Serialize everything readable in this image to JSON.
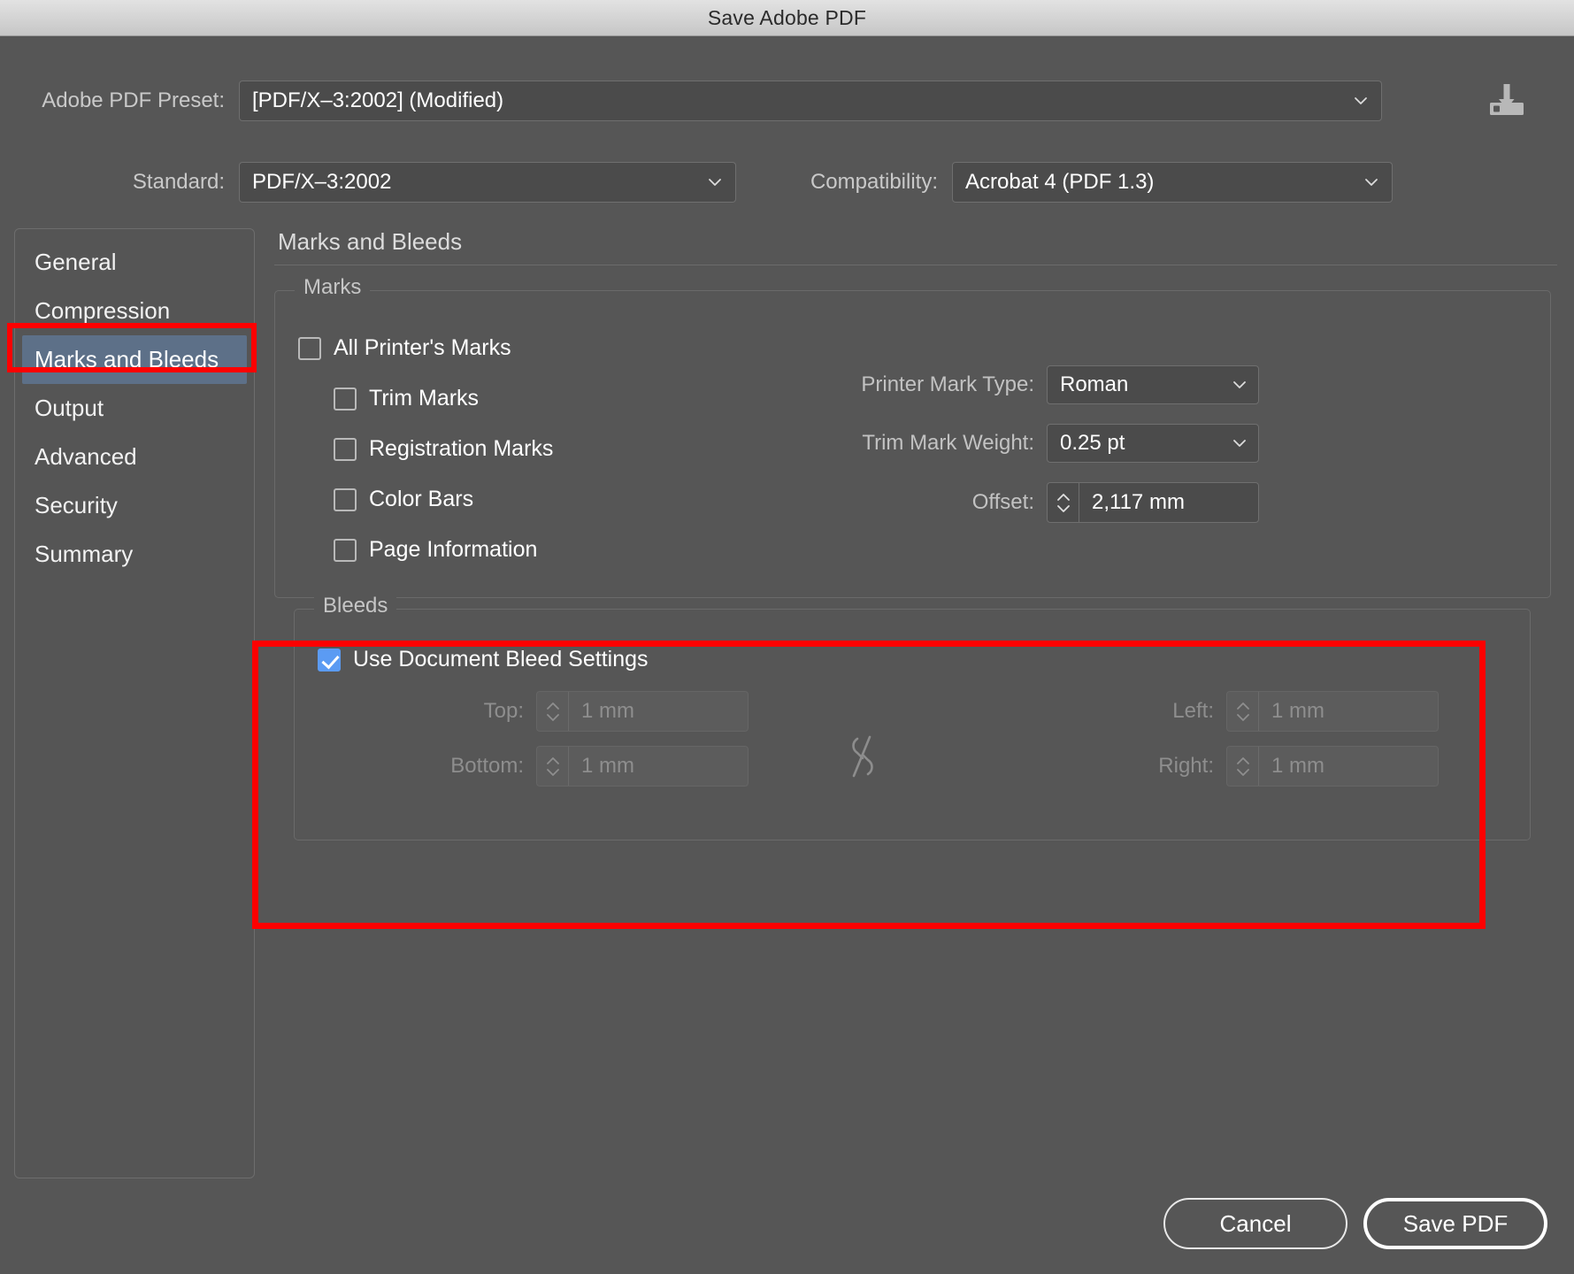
{
  "window": {
    "title": "Save Adobe PDF"
  },
  "top_form": {
    "preset_label": "Adobe PDF Preset:",
    "preset_value": "[PDF/X–3:2002] (Modified)",
    "save_preset_icon": "save-preset-icon",
    "standard_label": "Standard:",
    "standard_value": "PDF/X–3:2002",
    "compatibility_label": "Compatibility:",
    "compatibility_value": "Acrobat 4 (PDF 1.3)"
  },
  "sidebar": {
    "items": [
      {
        "label": "General",
        "selected": false
      },
      {
        "label": "Compression",
        "selected": false
      },
      {
        "label": "Marks and Bleeds",
        "selected": true
      },
      {
        "label": "Output",
        "selected": false
      },
      {
        "label": "Advanced",
        "selected": false
      },
      {
        "label": "Security",
        "selected": false
      },
      {
        "label": "Summary",
        "selected": false
      }
    ],
    "selected_highlight_color": "#5d7088"
  },
  "main": {
    "panel_title": "Marks and Bleeds",
    "marks_group": {
      "legend": "Marks",
      "checkboxes": [
        {
          "label": "All Printer's Marks",
          "checked": false,
          "indent": 0
        },
        {
          "label": "Trim Marks",
          "checked": false,
          "indent": 1
        },
        {
          "label": "Registration Marks",
          "checked": false,
          "indent": 1
        },
        {
          "label": "Color Bars",
          "checked": false,
          "indent": 1
        },
        {
          "label": "Page Information",
          "checked": false,
          "indent": 1
        }
      ],
      "fields": [
        {
          "label": "Printer Mark Type:",
          "value": "Roman",
          "type": "select"
        },
        {
          "label": "Trim Mark Weight:",
          "value": "0.25 pt",
          "type": "select"
        },
        {
          "label": "Offset:",
          "value": "2,117 mm",
          "type": "stepper"
        }
      ]
    },
    "bleeds_group": {
      "legend": "Bleeds",
      "use_document_bleed_label": "Use Document Bleed Settings",
      "use_document_bleed_checked": true,
      "link_icon": "broken-link-icon",
      "fields": [
        {
          "label": "Top:",
          "value": "1 mm",
          "disabled": true
        },
        {
          "label": "Bottom:",
          "value": "1 mm",
          "disabled": true
        },
        {
          "label": "Left:",
          "value": "1 mm",
          "disabled": true
        },
        {
          "label": "Right:",
          "value": "1 mm",
          "disabled": true
        }
      ]
    }
  },
  "footer": {
    "cancel_label": "Cancel",
    "save_label": "Save PDF"
  },
  "annotations": {
    "highlight_color": "#fe0000",
    "boxes": [
      "sidebar-marks-and-bleeds",
      "bleeds-section"
    ]
  }
}
